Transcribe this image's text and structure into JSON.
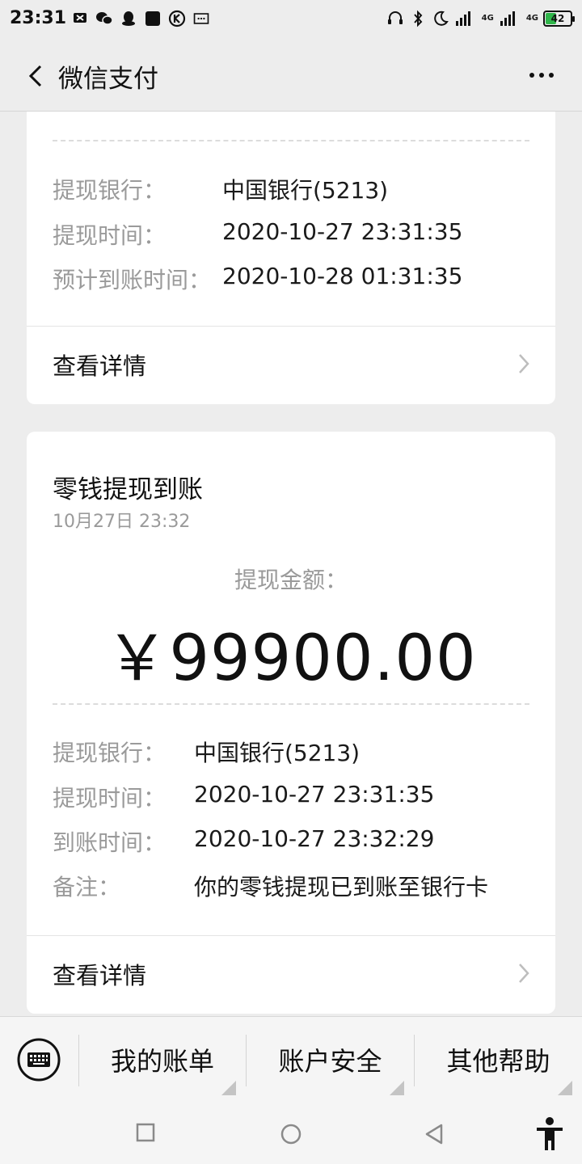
{
  "status_bar": {
    "time": "23:31",
    "net_1": "4G",
    "net_2": "4G",
    "battery_level": "42",
    "icons": [
      "notification-icon",
      "wechat-icon",
      "qq-icon",
      "app-icon",
      "k-icon",
      "message-icon",
      "headset-icon",
      "bluetooth-icon",
      "moon-icon",
      "signal-icon",
      "battery-icon"
    ]
  },
  "nav": {
    "title": "微信支付",
    "back_icon": "back-arrow-icon",
    "more_icon": "more-dots-icon"
  },
  "card1": {
    "rows": [
      {
        "label": "提现银行：",
        "value": "中国银行(5213)"
      },
      {
        "label": "提现时间：",
        "value": "2020-10-27 23:31:35"
      },
      {
        "label": "预计到账时间：",
        "value": "2020-10-28 01:31:35"
      }
    ],
    "detail_label": "查看详情"
  },
  "card2": {
    "title": "零钱提现到账",
    "date": "10月27日 23:32",
    "amount_label": "提现金额：",
    "amount": "￥99900.00",
    "rows": [
      {
        "label": "提现银行：",
        "value": "中国银行(5213)"
      },
      {
        "label": "提现时间：",
        "value": "2020-10-27 23:31:35"
      },
      {
        "label": "到账时间：",
        "value": "2020-10-27 23:32:29"
      },
      {
        "label": "备注：",
        "value": "你的零钱提现已到账至银行卡"
      }
    ],
    "detail_label": "查看详情"
  },
  "bottom_menu": {
    "items": [
      "我的账单",
      "账户安全",
      "其他帮助"
    ],
    "keyboard_icon": "keyboard-icon"
  },
  "android_nav": {
    "icons": [
      "recent-apps-icon",
      "home-icon",
      "back-triangle-icon",
      "accessibility-icon"
    ]
  },
  "colors": {
    "background": "#ededed",
    "card": "#ffffff",
    "label_gray": "#9a9a9a",
    "text": "#111111",
    "battery_green": "#2fb54a"
  }
}
